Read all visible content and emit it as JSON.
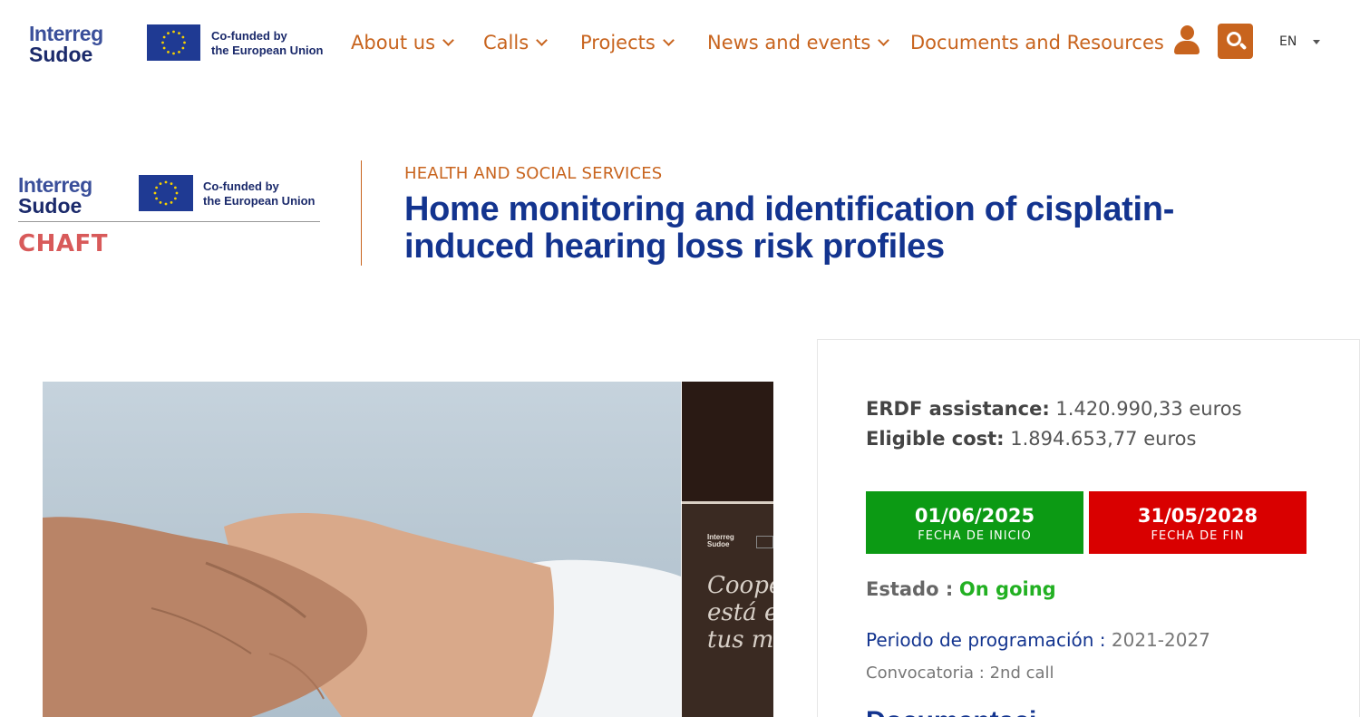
{
  "header": {
    "logo": {
      "line1": "Interreg",
      "line2": "Sudoe",
      "cofunded_line1": "Co-funded by",
      "cofunded_line2": "the European Union"
    },
    "nav": [
      {
        "label": "About us",
        "has_dropdown": true
      },
      {
        "label": "Calls",
        "has_dropdown": true
      },
      {
        "label": "Projects",
        "has_dropdown": true
      },
      {
        "label": "News and events",
        "has_dropdown": true
      },
      {
        "label": "Documents and Resources",
        "has_dropdown": false
      }
    ],
    "user_icon": "user-icon",
    "search_icon": "search-icon",
    "language": "EN"
  },
  "project": {
    "logo": {
      "line1": "Interreg",
      "line2": "Sudoe",
      "cofunded_line1": "Co-funded by",
      "cofunded_line2": "the European Union",
      "acronym": "CHAFT"
    },
    "category": "HEALTH AND SOCIAL SERVICES",
    "title": "Home monitoring and identification of cisplatin-induced hearing loss risk profiles"
  },
  "side_image": {
    "mini_logo_line1": "Interreg",
    "mini_logo_line2": "Sudoe",
    "slogan_lines": [
      "Coope",
      "está en",
      "tus ma"
    ]
  },
  "info": {
    "erdf_label": "ERDF assistance:",
    "erdf_value": "1.420.990,33 euros",
    "eligible_label": "Eligible cost:",
    "eligible_value": "1.894.653,77 euros",
    "start_date": "01/06/2025",
    "start_label": "FECHA DE INICIO",
    "end_date": "31/05/2028",
    "end_label": "FECHA DE FIN",
    "estado_label": "Estado :",
    "estado_value": "On going",
    "periodo_label": "Periodo de programación :",
    "periodo_value": "2021-2027",
    "convocatoria": "Convocatoria : 2nd call",
    "cut_heading": "Documentaci"
  },
  "colors": {
    "accent_orange": "#c8641e",
    "title_blue": "#13348f",
    "start_green": "#0c9a14",
    "end_red": "#d90000",
    "status_green": "#22b022",
    "acronym_red": "#d85a5a"
  }
}
